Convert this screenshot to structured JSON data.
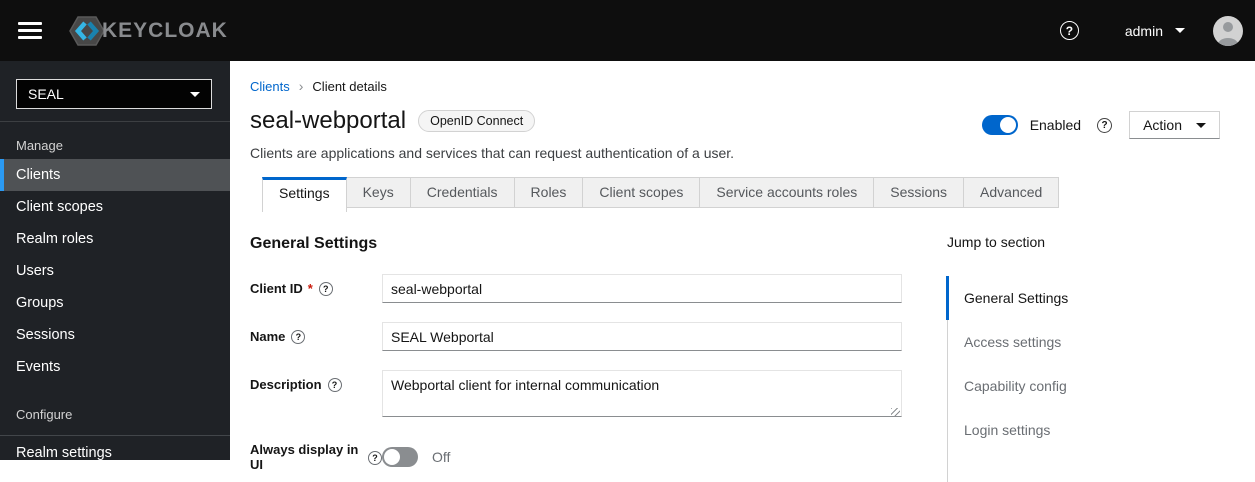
{
  "colors": {
    "accent_blue": "#0066cc",
    "nav_active_border": "#2b9af3",
    "required_red": "#c9190b",
    "toggle_off_gray": "#8a8d90",
    "masthead_bg": "#0e0e0e",
    "sidebar_bg": "#1f2226"
  },
  "masthead": {
    "brand": "KEYCLOAK",
    "help_icon": "?",
    "username": "admin"
  },
  "sidebar": {
    "realm_selector": {
      "value": "SEAL"
    },
    "groups": [
      {
        "label": "Manage",
        "items": [
          {
            "label": "Clients",
            "active": true
          },
          {
            "label": "Client scopes"
          },
          {
            "label": "Realm roles"
          },
          {
            "label": "Users"
          },
          {
            "label": "Groups"
          },
          {
            "label": "Sessions"
          },
          {
            "label": "Events"
          }
        ]
      },
      {
        "label": "Configure",
        "items": [
          {
            "label": "Realm settings"
          }
        ]
      }
    ]
  },
  "breadcrumb": {
    "items": [
      "Clients",
      "Client details"
    ]
  },
  "header": {
    "title": "seal-webportal",
    "badge": "OpenID Connect",
    "subtitle": "Clients are applications and services that can request authentication of a user.",
    "enabled_toggle": {
      "state": "on",
      "label": "Enabled"
    },
    "action_label": "Action"
  },
  "tabs": [
    {
      "label": "Settings",
      "active": true
    },
    {
      "label": "Keys"
    },
    {
      "label": "Credentials"
    },
    {
      "label": "Roles"
    },
    {
      "label": "Client scopes"
    },
    {
      "label": "Service accounts roles"
    },
    {
      "label": "Sessions"
    },
    {
      "label": "Advanced"
    }
  ],
  "form": {
    "section_title": "General Settings",
    "fields": [
      {
        "label": "Client ID",
        "required": "*",
        "value": "seal-webportal",
        "type": "input"
      },
      {
        "label": "Name",
        "value": "SEAL Webportal",
        "type": "input"
      },
      {
        "label": "Description",
        "value": "Webportal client for internal communication",
        "type": "textarea"
      },
      {
        "label": "Always display in UI",
        "type": "switch",
        "state": "off",
        "value": "Off"
      }
    ]
  },
  "jump_nav": {
    "title": "Jump to section",
    "items": [
      {
        "label": "General Settings",
        "active": true
      },
      {
        "label": "Access settings"
      },
      {
        "label": "Capability config"
      },
      {
        "label": "Login settings"
      }
    ]
  }
}
